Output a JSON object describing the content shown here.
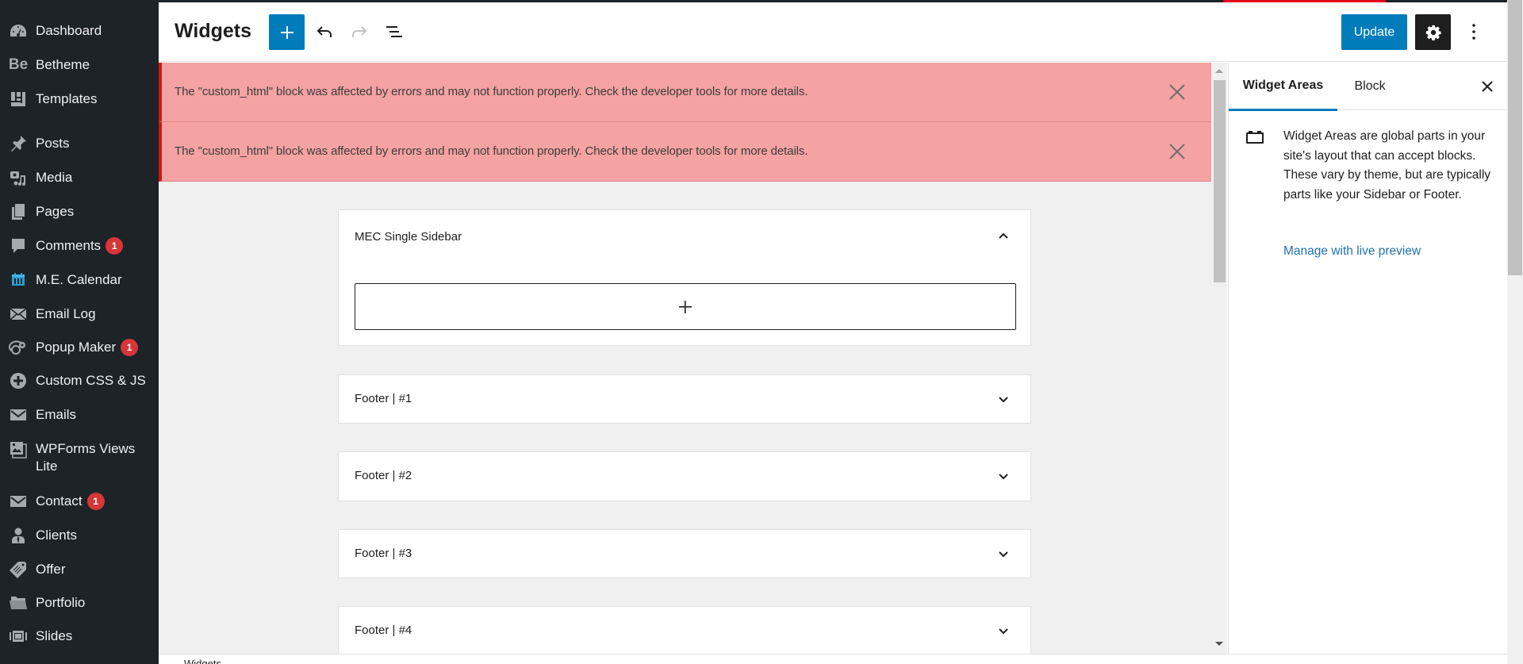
{
  "admin_menu": {
    "items": [
      {
        "label": "Dashboard",
        "icon": "dashboard-gauge-icon"
      },
      {
        "label": "Betheme",
        "icon": "betheme-be-icon"
      },
      {
        "label": "Templates",
        "icon": "templates-layout-icon"
      },
      {
        "label": "Posts",
        "icon": "pushpin-icon"
      },
      {
        "label": "Media",
        "icon": "media-camera-music-icon"
      },
      {
        "label": "Pages",
        "icon": "pages-icon"
      },
      {
        "label": "Comments",
        "icon": "comment-bubble-icon",
        "badge": "1"
      },
      {
        "label": "M.E. Calendar",
        "icon": "calendar-icon"
      },
      {
        "label": "Email Log",
        "icon": "envelope-open-icon"
      },
      {
        "label": "Popup Maker",
        "icon": "popup-maker-icon",
        "badge": "1"
      },
      {
        "label": "Custom CSS & JS",
        "icon": "plus-circle-icon"
      },
      {
        "label": "Emails",
        "icon": "envelope-icon"
      },
      {
        "label": "WPForms Views Lite",
        "icon": "wpforms-views-icon"
      },
      {
        "label": "Contact",
        "icon": "envelope-icon",
        "badge": "1"
      },
      {
        "label": "Clients",
        "icon": "person-icon"
      },
      {
        "label": "Offer",
        "icon": "price-tag-icon"
      },
      {
        "label": "Portfolio",
        "icon": "folder-open-icon"
      },
      {
        "label": "Slides",
        "icon": "slides-icon"
      }
    ]
  },
  "header": {
    "title": "Widgets",
    "inserter_label": "Add block",
    "undo_label": "Undo",
    "redo_label": "Redo",
    "list_view_label": "List View",
    "update_label": "Update",
    "settings_label": "Settings",
    "options_label": "Options"
  },
  "notices": [
    {
      "text": "The \"custom_html\" block was affected by errors and may not function properly. Check the developer tools for more details."
    },
    {
      "text": "The \"custom_html\" block was affected by errors and may not function properly. Check the developer tools for more details."
    }
  ],
  "widget_areas": [
    {
      "title": "MEC Single Sidebar",
      "expanded": true
    },
    {
      "title": "Footer | #1",
      "expanded": false
    },
    {
      "title": "Footer | #2",
      "expanded": false
    },
    {
      "title": "Footer | #3",
      "expanded": false
    },
    {
      "title": "Footer | #4",
      "expanded": false
    }
  ],
  "settings_panel": {
    "tabs": [
      {
        "label": "Widget Areas",
        "active": true
      },
      {
        "label": "Block",
        "active": false
      }
    ],
    "description": "Widget Areas are global parts in your site's layout that can accept blocks. These vary by theme, but are typically parts like your Sidebar or Footer.",
    "link_label": "Manage with live preview"
  },
  "status_bar": {
    "breadcrumb": "Widgets"
  },
  "colors": {
    "accent": "#007cba",
    "admin_bg": "#1d2327",
    "notice_bg": "#f4a2a2",
    "notice_border": "#cc1818",
    "badge": "#d63638",
    "link": "#2271b1"
  }
}
